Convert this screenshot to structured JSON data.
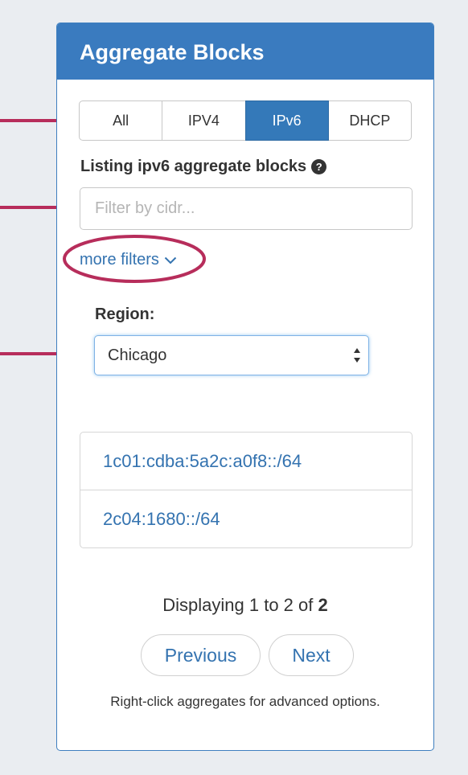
{
  "panel": {
    "title": "Aggregate Blocks"
  },
  "tabs": [
    {
      "label": "All",
      "active": false
    },
    {
      "label": "IPV4",
      "active": false
    },
    {
      "label": "IPv6",
      "active": true
    },
    {
      "label": "DHCP",
      "active": false
    }
  ],
  "listing": {
    "label": "Listing ipv6 aggregate blocks",
    "help_icon": "question-circle-icon"
  },
  "filter": {
    "placeholder": "Filter by cidr...",
    "value": ""
  },
  "more_filters": {
    "label": "more filters",
    "icon": "chevron-down-icon"
  },
  "region": {
    "label": "Region:",
    "selected": "Chicago"
  },
  "blocks": [
    {
      "cidr": "1c01:cdba:5a2c:a0f8::/64"
    },
    {
      "cidr": "2c04:1680::/64"
    }
  ],
  "pagination": {
    "display_prefix": "Displaying 1 to 2 of ",
    "total": "2",
    "previous_label": "Previous",
    "next_label": "Next"
  },
  "hint": "Right-click aggregates for advanced options.",
  "colors": {
    "header": "#3a7bbf",
    "active_tab": "#3479b9",
    "link": "#3473b0",
    "annotation": "#b72d5b",
    "background": "#eaedf1"
  }
}
